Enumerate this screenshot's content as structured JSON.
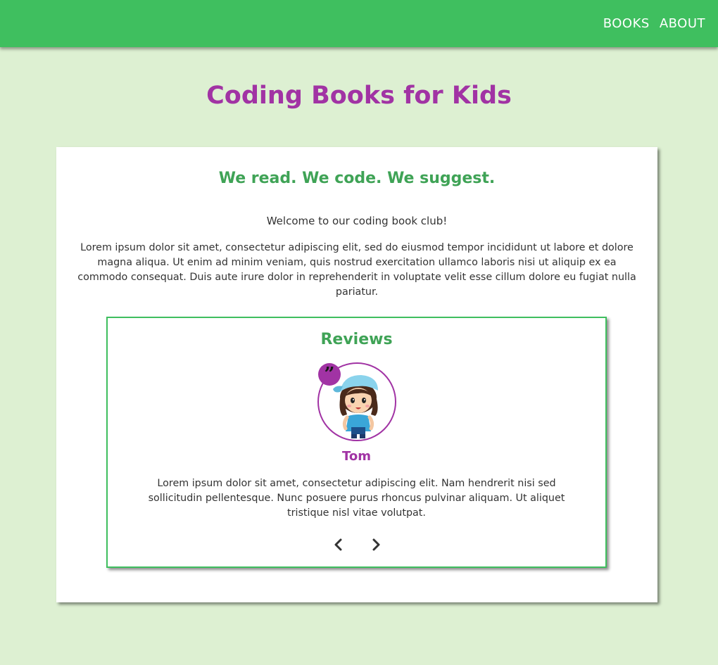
{
  "nav": {
    "books_label": "BOOKS",
    "about_label": "ABOUT"
  },
  "page_title": "Coding Books for Kids",
  "intro": {
    "tagline": "We read. We code. We suggest.",
    "welcome": "Welcome to our coding book club!",
    "body": "Lorem ipsum dolor sit amet, consectetur adipiscing elit, sed do eiusmod tempor incididunt ut labore et dolore magna aliqua. Ut enim ad minim veniam, quis nostrud exercitation ullamco laboris nisi ut aliquip ex ea commodo consequat. Duis aute irure dolor in reprehenderit in voluptate velit esse cillum dolore eu fugiat nulla pariatur."
  },
  "reviews": {
    "title": "Reviews",
    "quote_icon": "quote-icon",
    "reviewer_name": "Tom",
    "review_text": "Lorem ipsum dolor sit amet, consectetur adipiscing elit. Nam hendrerit nisi sed sollicitudin pellentesque. Nunc posuere purus rhoncus pulvinar aliquam. Ut aliquet tristique nisl vitae volutpat.",
    "prev_icon": "chevron-left-icon",
    "next_icon": "chevron-right-icon"
  },
  "colors": {
    "nav_green": "#3fbf5f",
    "background": "#ddf0d2",
    "title_purple": "#a133a4",
    "heading_green": "#3fa356"
  }
}
